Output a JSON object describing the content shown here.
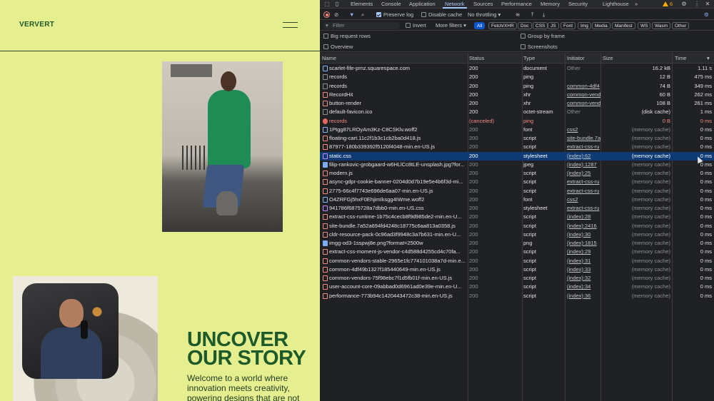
{
  "site": {
    "logo": "VERVERT",
    "headline_line1": "UNCOVER",
    "headline_line2": "OUR STORY",
    "intro": "Welcome to a world where innovation meets creativity, powering designs that are not"
  },
  "devtools": {
    "tabs": [
      "Elements",
      "Console",
      "Application",
      "Network",
      "Sources",
      "Performance",
      "Memory",
      "Security",
      "Lighthouse"
    ],
    "active_tab": "Network",
    "more_tabs": "»",
    "warnings_count": "6",
    "toolbar": {
      "preserve_log": "Preserve log",
      "disable_cache": "Disable cache",
      "throttling": "No throttling"
    },
    "filter": {
      "placeholder": "Filter",
      "invert": "Invert",
      "more_filters": "More filters",
      "types": [
        "All",
        "Fetch/XHR",
        "Doc",
        "CSS",
        "JS",
        "Font",
        "Img",
        "Media",
        "Manifest",
        "WS",
        "Wasm",
        "Other"
      ],
      "active_type": "All"
    },
    "options": {
      "big_request_rows": "Big request rows",
      "group_by_frame": "Group by frame",
      "overview": "Overview",
      "screenshots": "Screenshots"
    },
    "columns": {
      "name": "Name",
      "status": "Status",
      "type": "Type",
      "initiator": "Initiator",
      "size": "Size",
      "time": "Time"
    },
    "requests": [
      {
        "icon": "doc",
        "name": "scarlet-fife-prnz.squarespace.com",
        "status": "200",
        "type": "document",
        "initiator": "Other",
        "init_link": false,
        "size": "16.2 kB",
        "time": "1.11 s"
      },
      {
        "icon": "plain",
        "name": "records",
        "status": "200",
        "type": "ping",
        "initiator": "",
        "init_link": false,
        "size": "12 B",
        "time": "475 ms"
      },
      {
        "icon": "plain",
        "name": "records",
        "status": "200",
        "type": "ping",
        "initiator": "common-4df4",
        "init_link": true,
        "size": "74 B",
        "time": "349 ms"
      },
      {
        "icon": "script",
        "name": "RecordHit",
        "status": "200",
        "type": "xhr",
        "initiator": "common-vend",
        "init_link": true,
        "size": "60 B",
        "time": "262 ms"
      },
      {
        "icon": "script",
        "name": "button-render",
        "status": "200",
        "type": "xhr",
        "initiator": "common-vend",
        "init_link": true,
        "size": "108 B",
        "time": "261 ms"
      },
      {
        "icon": "plain",
        "name": "default-favicon.ico",
        "status": "200",
        "type": "octet-stream",
        "initiator": "Other",
        "init_link": false,
        "size": "(disk cache)",
        "time": "1 ms"
      },
      {
        "icon": "err",
        "name": "records",
        "status": "(canceled)",
        "type": "ping",
        "initiator": "",
        "init_link": false,
        "size": "0 B",
        "time": "0 ms",
        "error": true
      },
      {
        "icon": "font",
        "name": "1Ptgg87LROyAm3Kz-C8CSKlv.woff2",
        "status": "200",
        "type": "font",
        "initiator": "css2",
        "init_link": true,
        "size": "(memory cache)",
        "time": "0 ms"
      },
      {
        "icon": "script",
        "name": "floating-cart.11c2f1b3c1cb2ba0d418.js",
        "status": "200",
        "type": "script",
        "initiator": "site-bundle.7a",
        "init_link": true,
        "size": "(memory cache)",
        "time": "0 ms"
      },
      {
        "icon": "script",
        "name": "87977-180b339392f5120f4048-min.en-US.js",
        "status": "200",
        "type": "script",
        "initiator": "extract-css-ru",
        "init_link": true,
        "size": "(memory cache)",
        "time": "0 ms"
      },
      {
        "icon": "css",
        "name": "static.css",
        "status": "200",
        "type": "stylesheet",
        "initiator": "(index):62",
        "init_link": true,
        "size": "(memory cache)",
        "time": "0 ms",
        "selected": true
      },
      {
        "icon": "img",
        "name": "filip-rankovic-grobgaard-w6HLlCc8tLE-unsplash.jpg?for...",
        "status": "200",
        "type": "jpeg",
        "initiator": "(index):1287",
        "init_link": true,
        "size": "(memory cache)",
        "time": "0 ms"
      },
      {
        "icon": "script",
        "name": "modern.js",
        "status": "200",
        "type": "script",
        "initiator": "(index):25",
        "init_link": true,
        "size": "(memory cache)",
        "time": "0 ms"
      },
      {
        "icon": "script",
        "name": "async-gdpr-cookie-banner-0204d0d7b19e5e4b6f3d-mi...",
        "status": "200",
        "type": "script",
        "initiator": "extract-css-ru",
        "init_link": true,
        "size": "(memory cache)",
        "time": "0 ms"
      },
      {
        "icon": "script",
        "name": "2775-66c4f7743e696de6aa07-min.en-US.js",
        "status": "200",
        "type": "script",
        "initiator": "extract-css-ru",
        "init_link": true,
        "size": "(memory cache)",
        "time": "0 ms"
      },
      {
        "icon": "font",
        "name": "O4ZRFGj5hxF0EhjimIksgg4IWme.woff2",
        "status": "200",
        "type": "font",
        "initiator": "css2",
        "init_link": true,
        "size": "(memory cache)",
        "time": "0 ms"
      },
      {
        "icon": "css",
        "name": "941786f6875728a7dbb0-min.en-US.css",
        "status": "200",
        "type": "stylesheet",
        "initiator": "extract-css-ru",
        "init_link": true,
        "size": "(memory cache)",
        "time": "0 ms"
      },
      {
        "icon": "script",
        "name": "extract-css-runtime-1b75c4cecb8f9d985de2-min.en-U...",
        "status": "200",
        "type": "script",
        "initiator": "(index):28",
        "init_link": true,
        "size": "(memory cache)",
        "time": "0 ms"
      },
      {
        "icon": "script",
        "name": "site-bundle.7a52a694fd4248c18775c6aa813a0358.js",
        "status": "200",
        "type": "script",
        "initiator": "(index):2416",
        "init_link": true,
        "size": "(memory cache)",
        "time": "0 ms"
      },
      {
        "icon": "script",
        "name": "cldr-resource-pack-0c96ad3f9948c3a7b631-min.en-U...",
        "status": "200",
        "type": "script",
        "initiator": "(index):30",
        "init_link": true,
        "size": "(memory cache)",
        "time": "0 ms"
      },
      {
        "icon": "img",
        "name": "imgg-od3-1sspwj8e.png?format=2500w",
        "status": "200",
        "type": "png",
        "initiator": "(index):1815",
        "init_link": true,
        "size": "(memory cache)",
        "time": "0 ms"
      },
      {
        "icon": "script",
        "name": "extract-css-moment-js-vendor-c4d588d4255cd4c70fa...",
        "status": "200",
        "type": "script",
        "initiator": "(index):29",
        "init_link": true,
        "size": "(memory cache)",
        "time": "0 ms"
      },
      {
        "icon": "script",
        "name": "common-vendors-stable-2965e1fc774101038a7d-min.e...",
        "status": "200",
        "type": "script",
        "initiator": "(index):31",
        "init_link": true,
        "size": "(memory cache)",
        "time": "0 ms"
      },
      {
        "icon": "script",
        "name": "common-4df49b1327f185440649-min.en-US.js",
        "status": "200",
        "type": "script",
        "initiator": "(index):33",
        "init_link": true,
        "size": "(memory cache)",
        "time": "0 ms"
      },
      {
        "icon": "script",
        "name": "common-vendors-75f98ebc7f1d5fb01f-min.en-US.js",
        "status": "200",
        "type": "script",
        "initiator": "(index):32",
        "init_link": true,
        "size": "(memory cache)",
        "time": "0 ms"
      },
      {
        "icon": "script",
        "name": "user-account-core-09abbad0d6961ad0e39e-min.en-U...",
        "status": "200",
        "type": "script",
        "initiator": "(index):34",
        "init_link": true,
        "size": "(memory cache)",
        "time": "0 ms"
      },
      {
        "icon": "script",
        "name": "performance-773b94c1420443472c38-min.en-US.js",
        "status": "200",
        "type": "script",
        "initiator": "(index):36",
        "init_link": true,
        "size": "(memory cache)",
        "time": "0 ms"
      }
    ]
  }
}
